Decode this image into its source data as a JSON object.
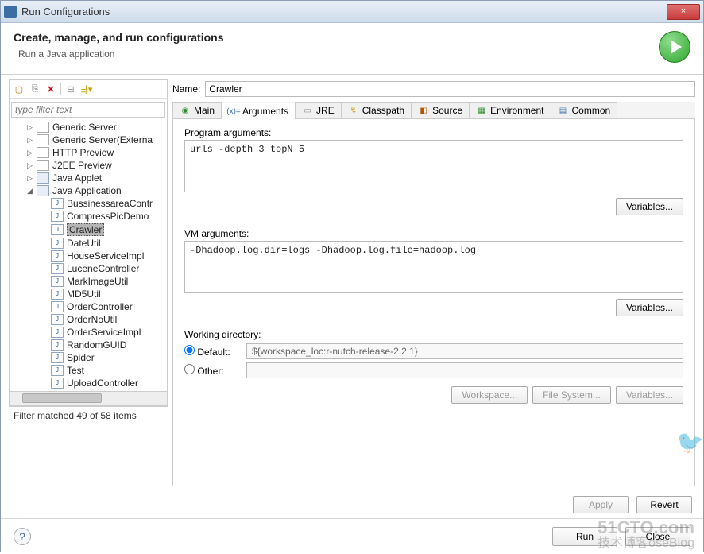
{
  "window": {
    "title": "Run Configurations",
    "close": "×"
  },
  "header": {
    "title": "Create, manage, and run configurations",
    "sub": "Run a Java application"
  },
  "filter": {
    "placeholder": "type filter text"
  },
  "tree": {
    "items": [
      {
        "label": "Generic Server",
        "lvl": 1,
        "icn": "srv"
      },
      {
        "label": "Generic Server(Externa",
        "lvl": 1,
        "icn": "srv"
      },
      {
        "label": "HTTP Preview",
        "lvl": 1,
        "icn": "srv"
      },
      {
        "label": "J2EE Preview",
        "lvl": 1,
        "icn": "srv"
      },
      {
        "label": "Java Applet",
        "lvl": 1,
        "icn": "ja"
      },
      {
        "label": "Java Application",
        "lvl": 1,
        "icn": "ja",
        "expanded": true
      },
      {
        "label": "BussinessareaContr",
        "lvl": 2,
        "icn": "J"
      },
      {
        "label": "CompressPicDemo",
        "lvl": 2,
        "icn": "J"
      },
      {
        "label": "Crawler",
        "lvl": 2,
        "icn": "J",
        "selected": true
      },
      {
        "label": "DateUtil",
        "lvl": 2,
        "icn": "J"
      },
      {
        "label": "HouseServiceImpl",
        "lvl": 2,
        "icn": "J"
      },
      {
        "label": "LuceneController",
        "lvl": 2,
        "icn": "J"
      },
      {
        "label": "MarkImageUtil",
        "lvl": 2,
        "icn": "J"
      },
      {
        "label": "MD5Util",
        "lvl": 2,
        "icn": "J"
      },
      {
        "label": "OrderController",
        "lvl": 2,
        "icn": "J"
      },
      {
        "label": "OrderNoUtil",
        "lvl": 2,
        "icn": "J"
      },
      {
        "label": "OrderServiceImpl",
        "lvl": 2,
        "icn": "J"
      },
      {
        "label": "RandomGUID",
        "lvl": 2,
        "icn": "J"
      },
      {
        "label": "Spider",
        "lvl": 2,
        "icn": "J"
      },
      {
        "label": "Test",
        "lvl": 2,
        "icn": "J"
      },
      {
        "label": "UploadController",
        "lvl": 2,
        "icn": "J"
      }
    ],
    "footer": "Filter matched 49 of 58 items"
  },
  "name": {
    "label": "Name:",
    "value": "Crawler"
  },
  "tabs": {
    "main": "Main",
    "args": "Arguments",
    "jre": "JRE",
    "classpath": "Classpath",
    "source": "Source",
    "env": "Environment",
    "common": "Common"
  },
  "args": {
    "progLabel": "Program arguments:",
    "progValue": "urls -depth 3 topN 5",
    "vmLabel": "VM arguments:",
    "vmValue": "-Dhadoop.log.dir=logs -Dhadoop.log.file=hadoop.log",
    "variables": "Variables...",
    "wdLabel": "Working directory:",
    "defaultLabel": "Default:",
    "otherLabel": "Other:",
    "defaultValue": "${workspace_loc:r-nutch-release-2.2.1}",
    "workspace": "Workspace...",
    "filesystem": "File System...",
    "vars2": "Variables..."
  },
  "buttons": {
    "apply": "Apply",
    "revert": "Revert",
    "run": "Run",
    "close": "Close"
  },
  "help": "?",
  "watermark1": "51CTO.com",
  "watermark2": "技术博客oseBlog"
}
